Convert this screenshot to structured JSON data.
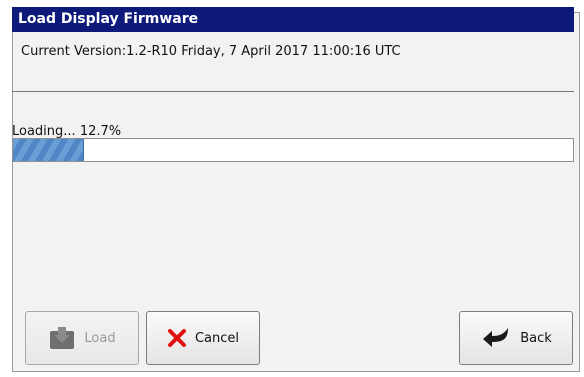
{
  "dialog": {
    "title": "Load Display Firmware",
    "current_version": "Current Version:1.2-R10  Friday, 7 April 2017 11:00:16 UTC"
  },
  "progress": {
    "label": "Loading... 12.7%",
    "value": 0.127
  },
  "buttons": {
    "load_label": "Load",
    "cancel_label": "Cancel",
    "back_label": "Back"
  },
  "icons": {
    "load": "download-icon",
    "cancel": "close-icon",
    "back": "back-arrow-icon"
  },
  "colors": {
    "title_bar": "#0d1a7a",
    "progress_fill": "#5b8fcd",
    "cancel_icon": "#e01010",
    "back_icon": "#1a1a1a"
  }
}
